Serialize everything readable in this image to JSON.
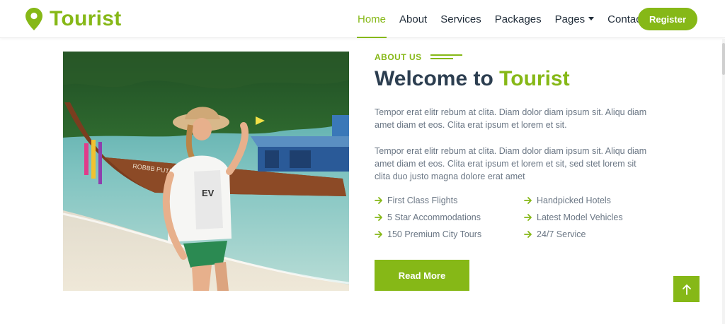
{
  "brand": {
    "name": "Tourist",
    "icon": "map-marker-icon",
    "color": "#86b817"
  },
  "nav": {
    "items": [
      {
        "label": "Home",
        "active": true
      },
      {
        "label": "About",
        "active": false
      },
      {
        "label": "Services",
        "active": false
      },
      {
        "label": "Packages",
        "active": false
      },
      {
        "label": "Pages",
        "active": false,
        "dropdown": true
      },
      {
        "label": "Contact",
        "active": false
      }
    ],
    "register_label": "Register"
  },
  "about": {
    "section_label": "ABOUT US",
    "title_prefix": "Welcome to",
    "title_accent": "Tourist",
    "paragraph1": "Tempor erat elitr rebum at clita. Diam dolor diam ipsum sit. Aliqu diam amet diam et eos. Clita erat ipsum et lorem et sit.",
    "paragraph2": "Tempor erat elitr rebum at clita. Diam dolor diam ipsum sit. Aliqu diam amet diam et eos. Clita erat ipsum et lorem et sit, sed stet lorem sit clita duo justo magna dolore erat amet",
    "features": [
      "First Class Flights",
      "Handpicked Hotels",
      "5 Star Accommodations",
      "Latest Model Vehicles",
      "150 Premium City Tours",
      "24/7 Service"
    ],
    "read_more_label": "Read More"
  },
  "icons": {
    "feature": "arrow-right-icon",
    "back_to_top": "arrow-up-icon"
  },
  "colors": {
    "accent": "#86b817",
    "heading": "#2c3e50",
    "body_text": "#6b7785"
  }
}
